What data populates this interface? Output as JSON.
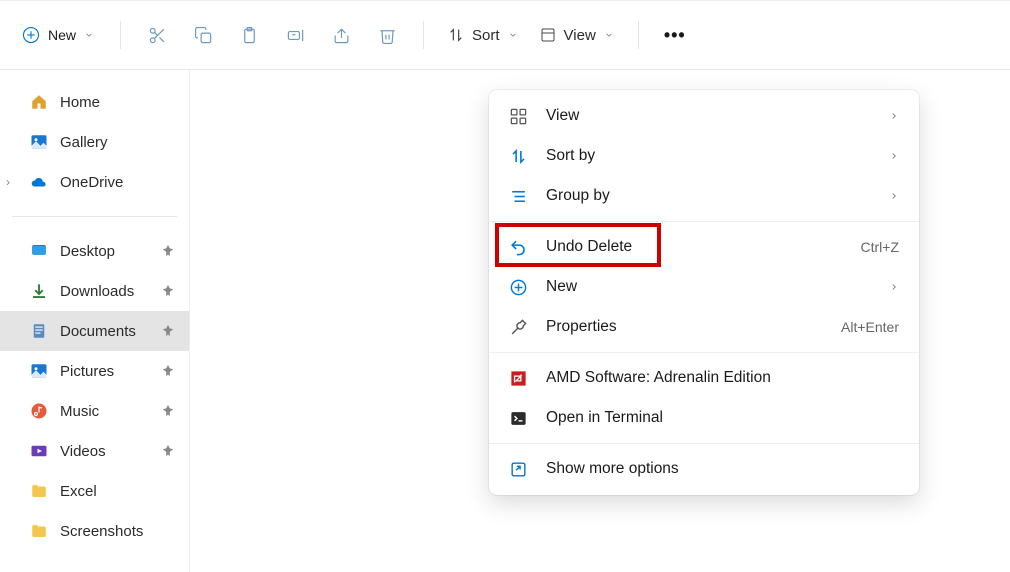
{
  "toolbar": {
    "new_label": "New",
    "sort_label": "Sort",
    "view_label": "View"
  },
  "sidebar": {
    "home": "Home",
    "gallery": "Gallery",
    "onedrive": "OneDrive",
    "desktop": "Desktop",
    "downloads": "Downloads",
    "documents": "Documents",
    "pictures": "Pictures",
    "music": "Music",
    "videos": "Videos",
    "excel": "Excel",
    "screenshots": "Screenshots"
  },
  "context_menu": {
    "view": "View",
    "sort_by": "Sort by",
    "group_by": "Group by",
    "undo_delete": "Undo Delete",
    "undo_shortcut": "Ctrl+Z",
    "new": "New",
    "properties": "Properties",
    "properties_shortcut": "Alt+Enter",
    "amd": "AMD Software: Adrenalin Edition",
    "terminal": "Open in Terminal",
    "more": "Show more options"
  }
}
